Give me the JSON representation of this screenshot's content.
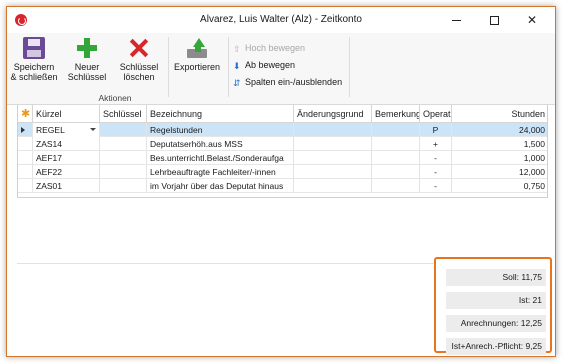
{
  "window": {
    "title": "Alvarez, Luis Walter (Alz) - Zeitkonto"
  },
  "ribbon": {
    "save_label_1": "Speichern",
    "save_label_2": "& schließen",
    "add_label_1": "Neuer",
    "add_label_2": "Schlüssel",
    "delete_label_1": "Schlüssel",
    "delete_label_2": "löschen",
    "export_label": "Exportieren",
    "move_up_label": "Hoch bewegen",
    "move_down_label": "Ab bewegen",
    "columns_label": "Spalten ein-/ausblenden",
    "group_label": "Aktionen"
  },
  "grid": {
    "columns": [
      "Kürzel",
      "Schlüssel",
      "Bezeichnung",
      "Änderungsgrund",
      "Bemerkung",
      "Operat",
      "Stunden"
    ],
    "rows": [
      {
        "kuerzel": "REGEL",
        "schluessel": "",
        "bezeichnung": "Regelstunden",
        "aenderungsgrund": "",
        "bemerkung": "",
        "operat": "P",
        "stunden": "24,000"
      },
      {
        "kuerzel": "ZAS14",
        "schluessel": "",
        "bezeichnung": "Deputatserhöh.aus MSS",
        "aenderungsgrund": "",
        "bemerkung": "",
        "operat": "+",
        "stunden": "1,500"
      },
      {
        "kuerzel": "AEF17",
        "schluessel": "",
        "bezeichnung": "Bes.unterrichtl.Belast./Sonderaufga",
        "aenderungsgrund": "",
        "bemerkung": "",
        "operat": "-",
        "stunden": "1,000"
      },
      {
        "kuerzel": "AEF22",
        "schluessel": "",
        "bezeichnung": "Lehrbeauftragte Fachleiter/-innen",
        "aenderungsgrund": "",
        "bemerkung": "",
        "operat": "-",
        "stunden": "12,000"
      },
      {
        "kuerzel": "ZAS01",
        "schluessel": "",
        "bezeichnung": "im Vorjahr über das Deputat hinaus",
        "aenderungsgrund": "",
        "bemerkung": "",
        "operat": "-",
        "stunden": "0,750"
      }
    ]
  },
  "summary": {
    "soll": "Soll: 11,75",
    "ist": "Ist: 21",
    "anrechnungen": "Anrechnungen: 12,25",
    "ist_anrech_pflicht": "Ist+Anrech.-Pflicht: 9,25"
  },
  "colors": {
    "accent_border": "#e8741f",
    "selected_row": "#cce4f7"
  }
}
